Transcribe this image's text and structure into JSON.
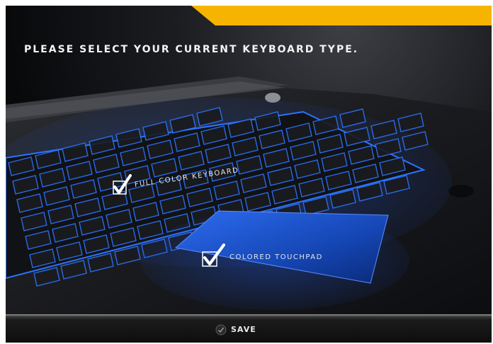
{
  "header": {
    "title": "Please select your current keyboard type."
  },
  "options": [
    {
      "label": "Full Color Keyboard",
      "checked": true
    },
    {
      "label": "Colored Touchpad",
      "checked": true
    }
  ],
  "footer": {
    "save_label": "SAVE"
  },
  "colors": {
    "accent": "#f6b400",
    "backlight": "#1e6cff",
    "touchpad": "#1c58d8",
    "background": "#101114"
  }
}
